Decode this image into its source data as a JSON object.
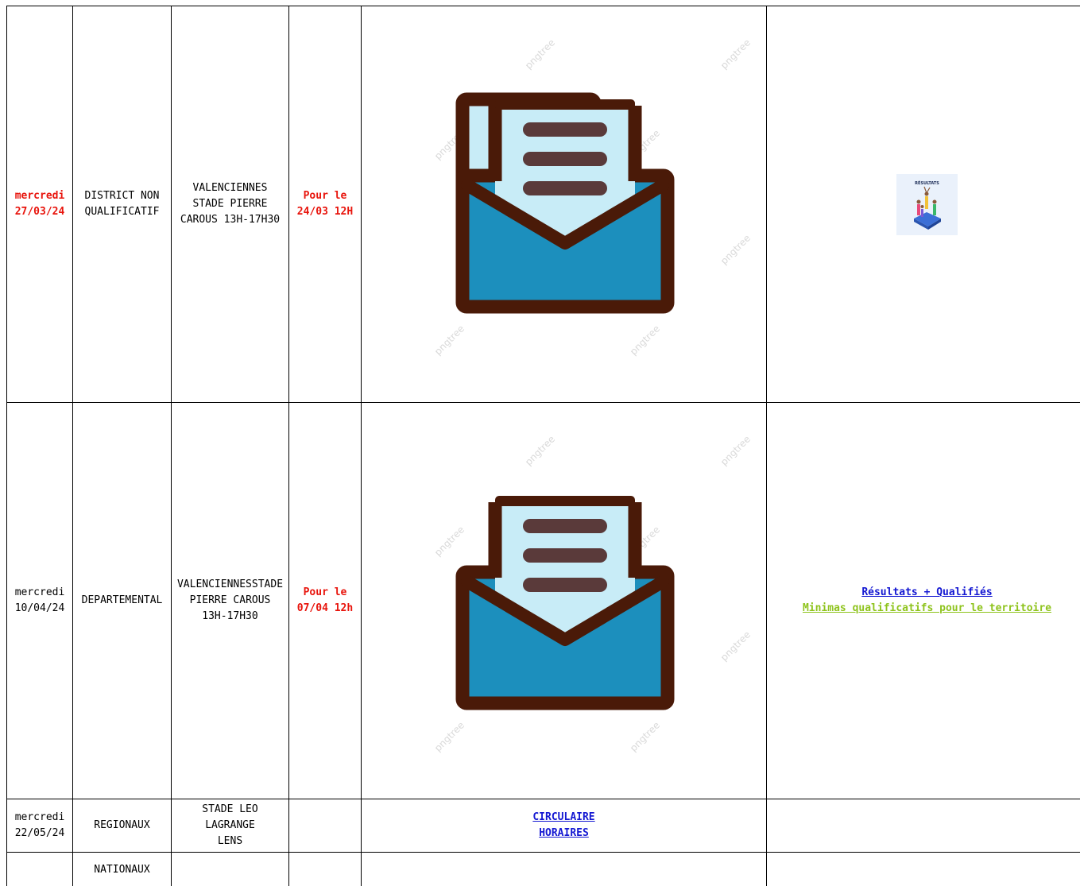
{
  "rows": [
    {
      "date_day": "mercredi",
      "date": "27/03/24",
      "level": [
        "DISTRICT NON",
        "QUALIFICATIF"
      ],
      "venue": [
        "VALENCIENNES",
        "STADE PIERRE",
        "CAROUS 13H-17H30"
      ],
      "deadline": [
        "Pour le",
        "24/03 12H"
      ],
      "results_badge_title": "RÉSULTATS"
    },
    {
      "date_day": "mercredi",
      "date": "10/04/24",
      "level": [
        "DEPARTEMENTAL"
      ],
      "venue": [
        "VALENCIENNESSTADE",
        "PIERRE CAROUS",
        "13H-17H30"
      ],
      "deadline": [
        "Pour le",
        "07/04 12h"
      ],
      "links": [
        "Résultats + Qualifiés",
        "Minimas qualificatifs pour le territoire"
      ]
    },
    {
      "date_day": "mercredi",
      "date": "22/05/24",
      "level": [
        "REGIONAUX"
      ],
      "venue": [
        "STADE LEO",
        "LAGRANGE",
        "LENS"
      ],
      "links": [
        "CIRCULAIRE",
        "HORAIRES"
      ]
    },
    {
      "level": [
        "NATIONAUX"
      ]
    }
  ],
  "watermark_text": "pngtree",
  "colors": {
    "deadline_red": "#e8140c",
    "link_blue": "#1418d2",
    "link_green": "#8ec31c",
    "envelope_outline": "#4a1a08",
    "envelope_blue": "#1c8fbd",
    "letter_paper": "#c8ecf7",
    "letter_lines": "#5a3a3a"
  },
  "icons": [
    "envelope-letter-icon",
    "results-podium-icon"
  ]
}
